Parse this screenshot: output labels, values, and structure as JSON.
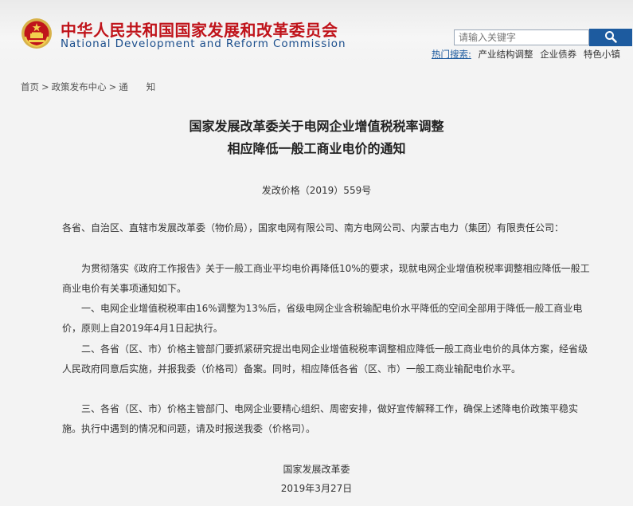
{
  "header": {
    "site_name_cn": "中华人民共和国国家发展和改革委员会",
    "site_name_en": "National Development and Reform Commission",
    "emblem_icon": "national-emblem-icon",
    "accent_red": "#c0141b",
    "accent_blue": "#1d5b9f"
  },
  "search": {
    "placeholder": "请输入关键字",
    "button_icon": "search-icon",
    "hot_label": "热门搜索:",
    "hot_items": [
      "产业结构调整",
      "企业债券",
      "特色小镇"
    ]
  },
  "breadcrumb": {
    "home": "首页",
    "section": "政策发布中心",
    "current": "通　　知",
    "separator": ">"
  },
  "article": {
    "title_line1": "国家发展改革委关于电网企业增值税税率调整",
    "title_line2": "相应降低一般工商业电价的通知",
    "doc_number": "发改价格（2019）559号",
    "salutation": "各省、自治区、直辖市发展改革委（物价局），国家电网有限公司、南方电网公司、内蒙古电力（集团）有限责任公司：",
    "para_intro": "为贯彻落实《政府工作报告》关于一般工商业平均电价再降低10%的要求，现就电网企业增值税税率调整相应降低一般工商业电价有关事项通知如下。",
    "para_1": "一、电网企业增值税税率由16%调整为13%后，省级电网企业含税输配电价水平降低的空间全部用于降低一般工商业电价，原则上自2019年4月1日起执行。",
    "para_2": "二、各省（区、市）价格主管部门要抓紧研究提出电网企业增值税税率调整相应降低一般工商业电价的具体方案，经省级人民政府同意后实施，并报我委（价格司）备案。同时，相应降低各省（区、市）一般工商业输配电价水平。",
    "para_3": "三、各省（区、市）价格主管部门、电网企业要精心组织、周密安排，做好宣传解释工作，确保上述降电价政策平稳实施。执行中遇到的情况和问题，请及时报送我委（价格司）。",
    "issuer": "国家发展改革委",
    "date": "2019年3月27日"
  }
}
